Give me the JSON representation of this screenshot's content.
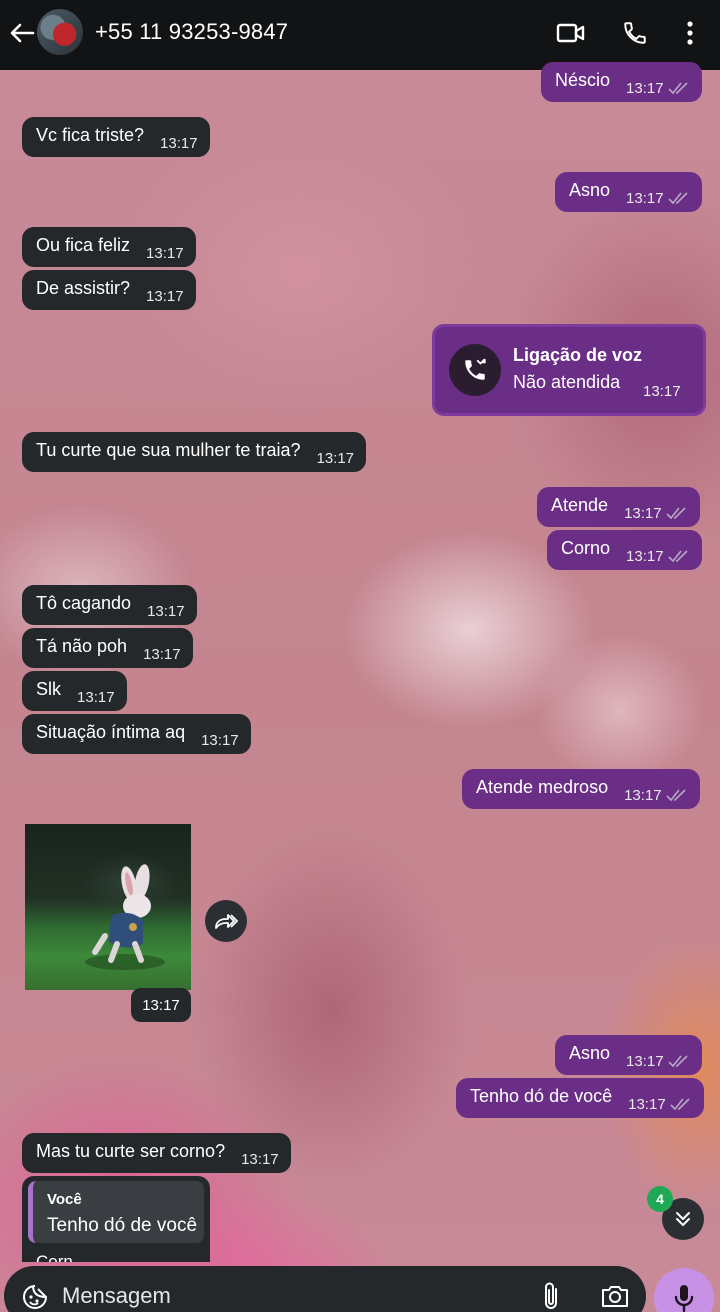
{
  "header": {
    "contact": "+55 11 93253-9847",
    "icons": [
      "back-arrow-icon",
      "video-camera-icon",
      "phone-icon",
      "more-vertical-icon"
    ]
  },
  "messages": [
    {
      "dir": "out",
      "text": "Néscio",
      "time": "13:17",
      "read": true
    },
    {
      "dir": "in",
      "text": "Vc fica triste?",
      "time": "13:17"
    },
    {
      "dir": "out",
      "text": "Asno",
      "time": "13:17",
      "read": true
    },
    {
      "dir": "in",
      "text": "Ou fica feliz",
      "time": "13:17"
    },
    {
      "dir": "in",
      "text": "De assistir?",
      "time": "13:17"
    },
    {
      "dir": "in",
      "text": "Tu curte que sua mulher te traia?",
      "time": "13:17"
    },
    {
      "dir": "out",
      "text": "Atende",
      "time": "13:17",
      "read": true
    },
    {
      "dir": "out",
      "text": "Corno",
      "time": "13:17",
      "read": true
    },
    {
      "dir": "in",
      "text": "Tô cagando",
      "time": "13:17"
    },
    {
      "dir": "in",
      "text": "Tá não poh",
      "time": "13:17"
    },
    {
      "dir": "in",
      "text": "Slk",
      "time": "13:17"
    },
    {
      "dir": "in",
      "text": "Situação íntima aq",
      "time": "13:17"
    },
    {
      "dir": "out",
      "text": "Atende medroso",
      "time": "13:17",
      "read": true
    },
    {
      "dir": "out",
      "text": "Asno",
      "time": "13:17",
      "read": true
    },
    {
      "dir": "out",
      "text": "Tenho dó de você",
      "time": "13:17",
      "read": true
    },
    {
      "dir": "in",
      "text": "Mas tu curte ser corno?",
      "time": "13:17"
    }
  ],
  "call": {
    "title": "Ligação de voz",
    "status": "Não atendida",
    "time": "13:17",
    "icon": "missed-call-icon"
  },
  "sticker": {
    "description_icon": "white-rabbit-sticker",
    "time": "13:17"
  },
  "reply": {
    "author": "Você",
    "quoted": "Tenho dó de você",
    "partial_text": "Corn"
  },
  "scroll": {
    "unread_count": "4"
  },
  "composer": {
    "placeholder": "Mensagem",
    "icons": [
      "emoji-icon",
      "paperclip-icon",
      "camera-icon",
      "microphone-icon"
    ]
  },
  "colors": {
    "outgoing_bubble": "#6b2e86",
    "incoming_bubble": "#24282b",
    "header": "#111315",
    "mic_button": "#c792e6",
    "unread_badge": "#1fa855"
  }
}
